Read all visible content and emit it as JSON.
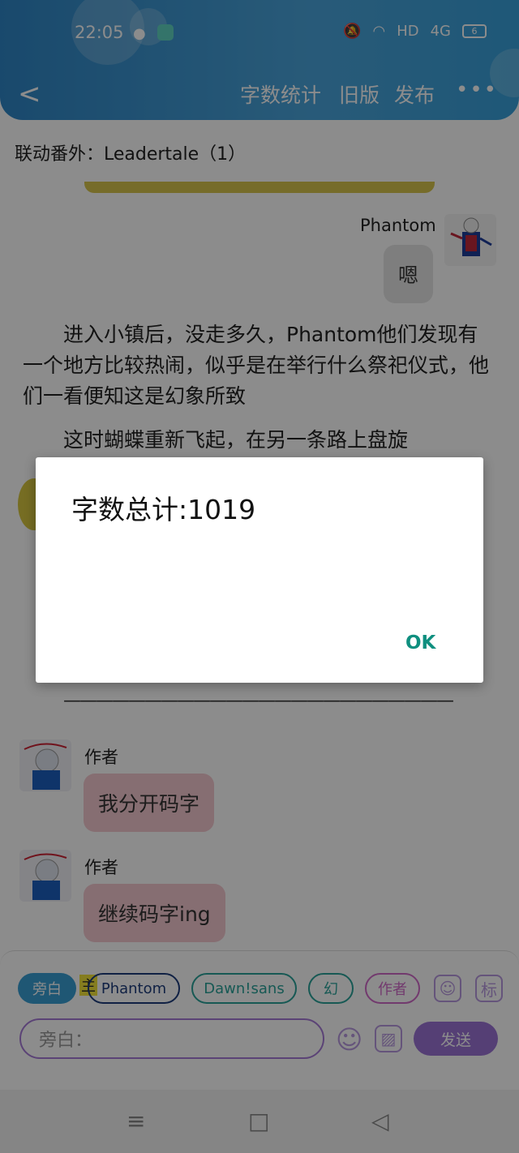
{
  "status_bar": {
    "time": "22:05",
    "network": "HD",
    "signal": "4G",
    "battery": "6"
  },
  "toolbar": {
    "word_count": "字数统计",
    "old_version": "旧版",
    "publish": "发布"
  },
  "chapter": {
    "title": "联动番外：Leadertale（1）"
  },
  "messages": {
    "phantom_name": "Phantom",
    "phantom_text": "嗯",
    "narration_1": "进入小镇后，没走多久，Phantom他们发现有一个地方比较热闹，似乎是在举行什么祭祀仪式，他们一看便知这是幻象所致",
    "narration_2": "这时蝴蝶重新飞起，在另一条路上盘旋",
    "divider": "————————————————————————",
    "author_name_1": "作者",
    "author_text_1": "我分开码字",
    "author_name_2": "作者",
    "author_text_2": "继续码字ing"
  },
  "chips": {
    "narrator": "旁白",
    "main_badge": "主",
    "phantom": "Phantom",
    "dawn": "Dawn!sans",
    "huan": "幻",
    "author": "作者",
    "tag": "标"
  },
  "input": {
    "placeholder": "旁白：",
    "send": "发送"
  },
  "dialog": {
    "message": "字数总计:1019",
    "ok": "OK"
  },
  "colors": {
    "header": "#3a95d0",
    "send": "#9b73d6",
    "ok": "#0f8f7f"
  }
}
